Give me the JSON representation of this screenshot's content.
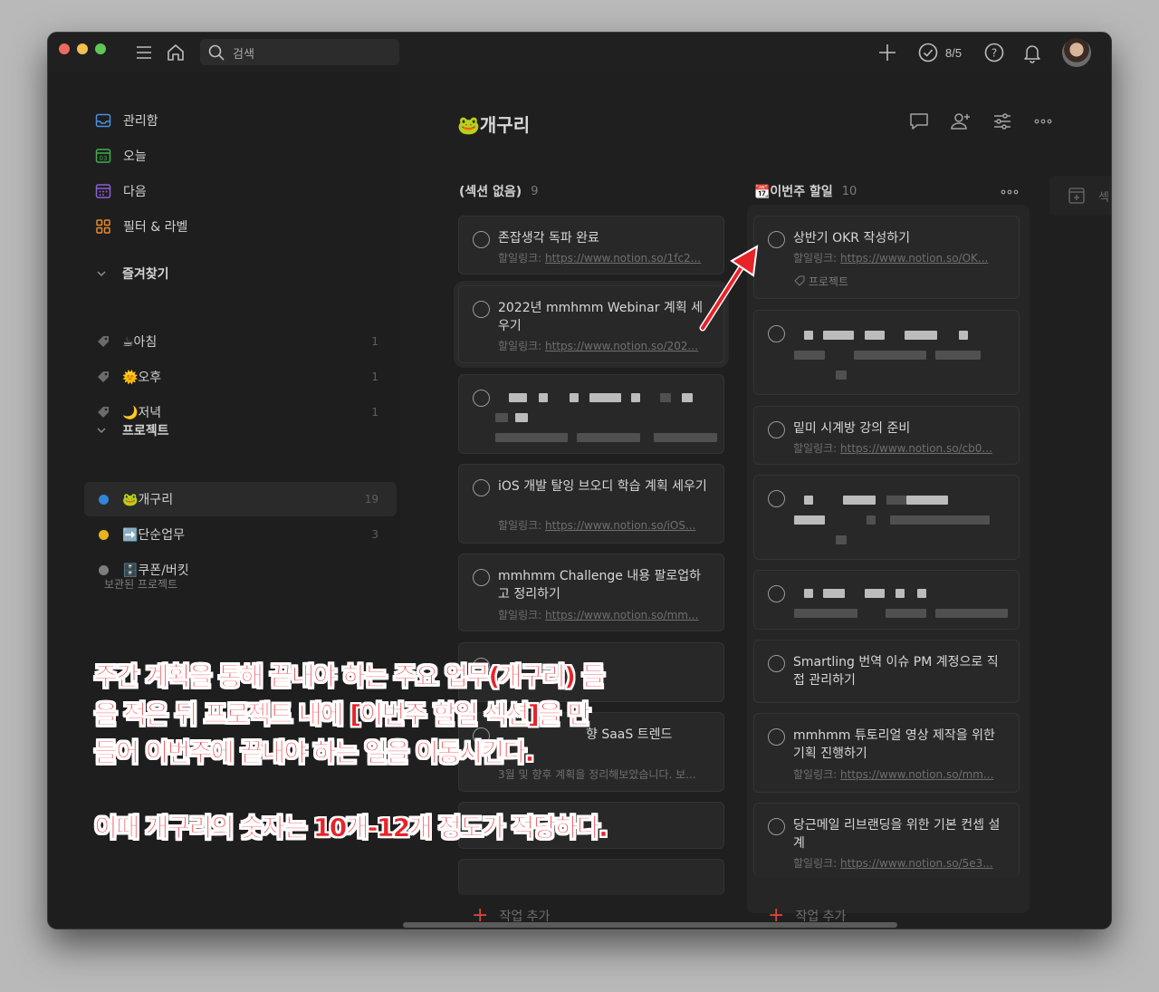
{
  "colors": {
    "accent_red": "#e8232a",
    "brand_red": "#d6473b",
    "project_blue": "#2f86d6",
    "project_yellow": "#e6b422",
    "project_grey": "#7d7d7d"
  },
  "topbar": {
    "search_placeholder": "검색",
    "productivity_count": "8/5",
    "icons": [
      "menu-icon",
      "home-icon",
      "search-icon",
      "plus-icon",
      "check-circle-icon",
      "help-icon",
      "bell-icon",
      "avatar"
    ]
  },
  "sidebar": {
    "nav": [
      {
        "label": "관리함",
        "icon": "inbox-icon"
      },
      {
        "label": "오늘",
        "icon": "calendar-today-icon"
      },
      {
        "label": "다음",
        "icon": "calendar-upcoming-icon"
      },
      {
        "label": "필터 & 라벨",
        "icon": "filters-icon"
      }
    ],
    "favorites_header": "즐겨찾기",
    "favorites": [
      {
        "label": "☕아침",
        "count": "1"
      },
      {
        "label": "🌞오후",
        "count": "1"
      },
      {
        "label": "🌙저녁",
        "count": "1"
      }
    ],
    "projects_header": "프로젝트",
    "projects": [
      {
        "label": "🐸개구리",
        "count": "19"
      },
      {
        "label": "➡️단순업무",
        "count": "3"
      },
      {
        "label": "🗄️쿠폰/버킷",
        "count": ""
      }
    ],
    "archived": "보관된 프로젝트"
  },
  "main": {
    "title": "🐸개구리",
    "header_icons": [
      "comment-icon",
      "add-person-icon",
      "settings-icon",
      "more-icon"
    ],
    "columns": [
      {
        "name": "(섹션 없음)",
        "count": "9",
        "cards": [
          {
            "title": "존잡생각 독파 완료",
            "label": "할일링크: ",
            "link": "https://www.notion.so/1fc2..."
          },
          {
            "title": "2022년 mmhmm Webinar 계획 세우기",
            "label": "할일링크: ",
            "link": "https://www.notion.so/202..."
          },
          {
            "title": "iOS 개발 탈잉 브오디 학습 계획 세우기",
            "label": "할일링크: ",
            "link": "https://www.notion.so/iOS..."
          },
          {
            "title": "mmhmm Challenge 내용 팔로업하고 정리하기",
            "label": "할일링크: ",
            "link": "https://www.notion.so/mm..."
          },
          {
            "title": "향 SaaS 트렌드",
            "label": "3월 및 향후 계획을 정리해보았습니다. 보..."
          }
        ],
        "add_task": "작업 추가"
      },
      {
        "name": "📆이번주 할일",
        "count": "10",
        "cards": [
          {
            "title": "상반기 OKR 작성하기",
            "label": "할일링크: ",
            "link": "https://www.notion.so/OK...",
            "tag": "프로젝트"
          },
          {
            "title": "밑미 시계방 강의 준비",
            "label": "할일링크: ",
            "link": "https://www.notion.so/cb0..."
          },
          {
            "title": "Smartling 번역 이슈 PM 계정으로 직접 관리하기"
          },
          {
            "title": "mmhmm 튜토리얼 영상 제작을 위한 기획 진행하기",
            "label": "할일링크: ",
            "link": "https://www.notion.so/mm..."
          },
          {
            "title": "당근메일 리브랜딩을 위한 기본 컨셉 설계",
            "label": "할일링크: ",
            "link": "https://www.notion.so/5e3..."
          }
        ],
        "add_task": "작업 추가"
      }
    ],
    "ghost_column": "섹"
  },
  "annotation": {
    "line1": "주간 계획을 통해 끝내야 하는 주요 업무(개구리) 들",
    "line2": "을 적은 뒤 프로젝트 내에 [이번주 할일 섹션]을 만",
    "line3": "들어 이번주에 끝내야 하는 일을 이동시킨다.",
    "line4": "이때 개구리의 숫자는 10개-12개 정도가 적당하다."
  }
}
